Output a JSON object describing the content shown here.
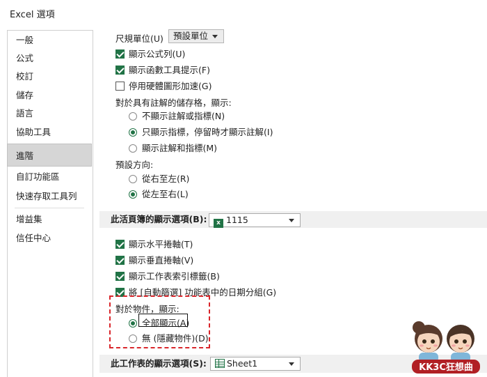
{
  "window": {
    "title": "Excel 選項"
  },
  "sidebar": {
    "items": [
      {
        "label": "一般"
      },
      {
        "label": "公式"
      },
      {
        "label": "校訂"
      },
      {
        "label": "儲存"
      },
      {
        "label": "語言"
      },
      {
        "label": "協助工具"
      },
      {
        "label": "進階",
        "selected": true
      },
      {
        "label": "自訂功能區"
      },
      {
        "label": "快速存取工具列"
      },
      {
        "label": "增益集"
      },
      {
        "label": "信任中心"
      }
    ]
  },
  "display": {
    "ruler_units_label": "尺規單位(U)",
    "ruler_units_value": "預設單位",
    "show_formula_bar": {
      "label": "顯示公式列(U)",
      "checked": true
    },
    "show_function_tooltips": {
      "label": "顯示函數工具提示(F)",
      "checked": true
    },
    "disable_hw_acceleration": {
      "label": "停用硬體圖形加速(G)",
      "checked": false
    },
    "comments_label": "對於具有註解的儲存格，顯示:",
    "comments_options": [
      {
        "label": "不顯示註解或指標(N)",
        "selected": false
      },
      {
        "label": "只顯示指標，停留時才顯示註解(I)",
        "selected": true
      },
      {
        "label": "顯示註解和指標(M)",
        "selected": false
      }
    ],
    "direction_label": "預設方向:",
    "direction_options": [
      {
        "label": "從右至左(R)",
        "selected": false
      },
      {
        "label": "從左至右(L)",
        "selected": true
      }
    ]
  },
  "workbook_section": {
    "header": "此活頁簿的顯示選項(B):",
    "workbook_value": "1115",
    "workbook_icon": "excel-icon",
    "show_horizontal_scrollbar": {
      "label": "顯示水平捲軸(T)",
      "checked": true
    },
    "show_vertical_scrollbar": {
      "label": "顯示垂直捲軸(V)",
      "checked": true
    },
    "show_sheet_tabs": {
      "label": "顯示工作表索引標籤(B)",
      "checked": true
    },
    "group_dates": {
      "label": "將 [自動篩選] 功能表中的日期分組(G)",
      "checked": true
    },
    "objects_label": "對於物件，顯示:",
    "objects_options": [
      {
        "label": "全部顯示(A)",
        "selected": true
      },
      {
        "label": "無 (隱藏物件)(D)",
        "selected": false
      }
    ]
  },
  "worksheet_section": {
    "header": "此工作表的顯示選項(S):",
    "worksheet_value": "Sheet1",
    "worksheet_icon": "sheet-icon"
  },
  "watermark": {
    "text": "KK3C狂想曲"
  },
  "colors": {
    "accent": "#217346",
    "highlight": "#d9262b",
    "selected_nav": "#d6d6d6"
  }
}
